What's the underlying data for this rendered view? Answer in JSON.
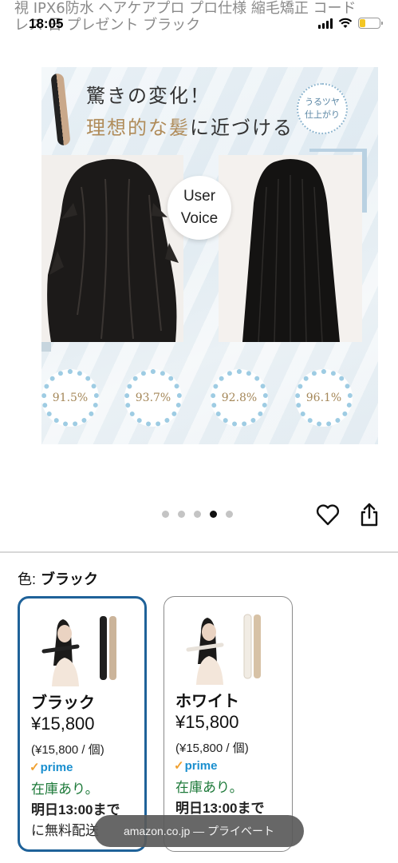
{
  "status_bar": {
    "time": "18:05"
  },
  "page_title_fragment": {
    "line1": "視 IPX6防水 ヘアケアプロ プロ仕様 縮毛矯正 コード",
    "line2": "レス 日 プレゼント ブラック"
  },
  "banner": {
    "headline_line1": "驚きの変化！",
    "headline_line2_gold": "理想的な髪",
    "headline_line2_rest": "に近づける",
    "badge_line1": "うるツヤ",
    "badge_line2": "仕上がり",
    "circle_line1": "User",
    "circle_line2": "Voice",
    "stats": [
      "91.5%",
      "93.7%",
      "92.8%",
      "96.1%"
    ]
  },
  "carousel": {
    "total": 5,
    "active_index": 3
  },
  "color_selector": {
    "label": "色:",
    "selected": "ブラック",
    "options": [
      {
        "name": "ブラック",
        "price": "¥15,800",
        "unit_price": "(¥15,800 / 個)",
        "prime": "prime",
        "stock": "在庫あり。",
        "delivery": "明日13:00まで",
        "delivery2": "に無料配送",
        "selected": true
      },
      {
        "name": "ホワイト",
        "price": "¥15,800",
        "unit_price": "(¥15,800 / 個)",
        "prime": "prime",
        "stock": "在庫あり。",
        "delivery": "明日13:00まで",
        "delivery2": "",
        "selected": false
      }
    ]
  },
  "toast": {
    "text": "amazon.co.jp — プライベート"
  },
  "colors": {
    "selected_border": "#1f6299",
    "prime_blue": "#1a8fcf",
    "in_stock_green": "#1e7a3a",
    "stat_gold": "#a5885a"
  },
  "icons": {
    "like": "heart-icon",
    "share": "share-icon",
    "prime_check": "check-icon"
  }
}
